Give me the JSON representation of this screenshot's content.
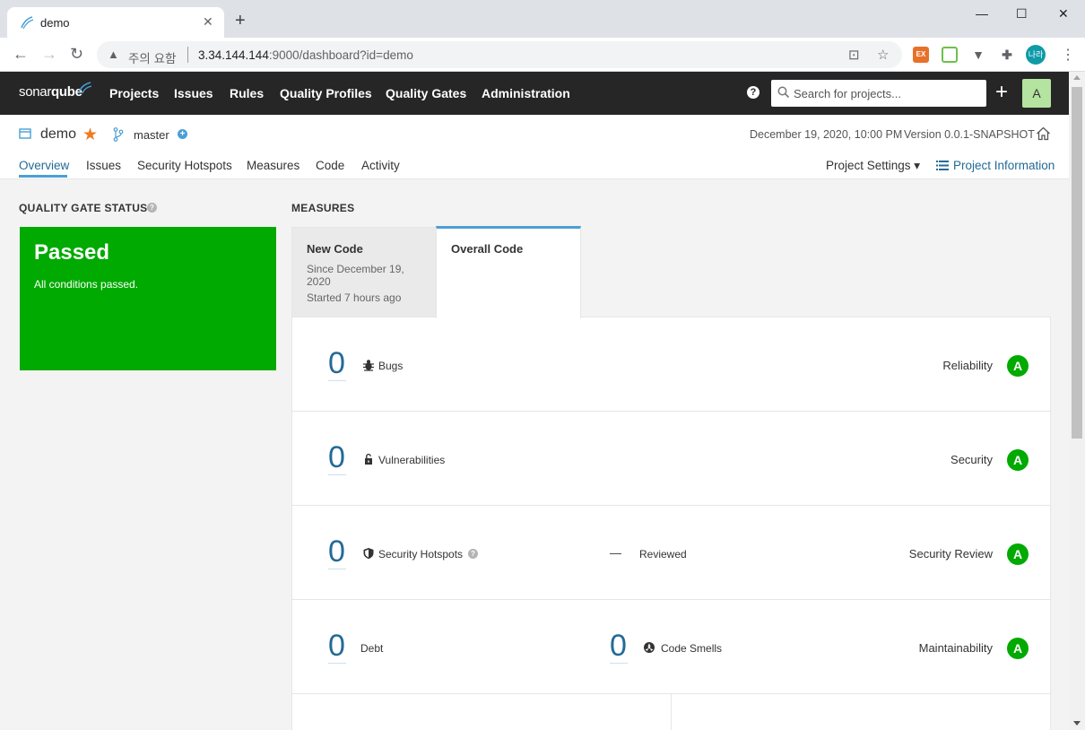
{
  "browser": {
    "tab_title": "demo",
    "security_label": "주의 요함",
    "url_host": "3.34.144.144",
    "url_rest": ":9000/dashboard?id=demo",
    "profile_initials": "나라",
    "ext_label": "EX"
  },
  "nav": {
    "logo_light": "sonar",
    "logo_bold": "qube",
    "items": [
      "Projects",
      "Issues",
      "Rules",
      "Quality Profiles",
      "Quality Gates",
      "Administration"
    ],
    "search_placeholder": "Search for projects...",
    "avatar_letter": "A"
  },
  "project": {
    "name": "demo",
    "branch": "master",
    "analysis_date": "December 19, 2020, 10:00 PM",
    "version": "Version 0.0.1-SNAPSHOT",
    "tabs": [
      "Overview",
      "Issues",
      "Security Hotspots",
      "Measures",
      "Code",
      "Activity"
    ],
    "settings_label": "Project Settings ▾",
    "info_label": "Project Information"
  },
  "quality_gate": {
    "title": "QUALITY GATE STATUS",
    "status": "Passed",
    "description": "All conditions passed.",
    "color": "#00aa00"
  },
  "measures": {
    "title": "MEASURES",
    "new_code": {
      "label": "New Code",
      "since": "Since December 19, 2020",
      "started": "Started 7 hours ago"
    },
    "overall_label": "Overall Code",
    "rows": [
      {
        "value": "0",
        "label": "Bugs",
        "rating_label": "Reliability",
        "rating": "A"
      },
      {
        "value": "0",
        "label": "Vulnerabilities",
        "rating_label": "Security",
        "rating": "A"
      },
      {
        "value": "0",
        "label": "Security Hotspots",
        "reviewed_dash": "—",
        "reviewed_label": "Reviewed",
        "rating_label": "Security Review",
        "rating": "A"
      },
      {
        "value": "0",
        "label": "Debt",
        "value2": "0",
        "label2": "Code Smells",
        "rating_label": "Maintainability",
        "rating": "A"
      }
    ]
  }
}
